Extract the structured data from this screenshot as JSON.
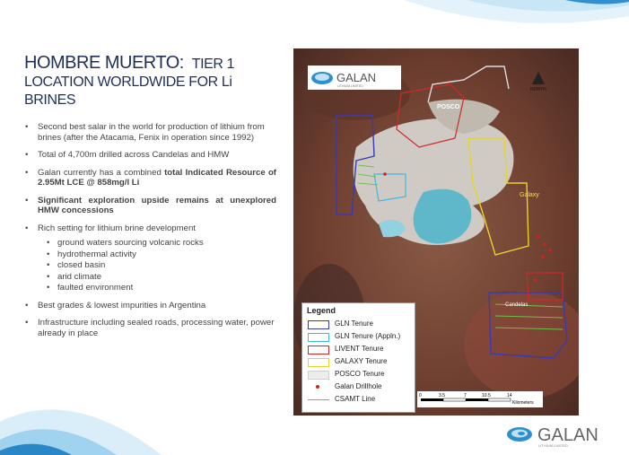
{
  "title": {
    "main": "HOMBRE MUERTO:",
    "tier": "TIER 1",
    "line2": "LOCATION WORLDWIDE FOR Li",
    "line3": "BRINES"
  },
  "bullets": [
    {
      "text": "Second best salar in the world for production of lithium from brines (after the Atacama, Fenix in operation since 1992)"
    },
    {
      "text": "Total of 4,700m drilled across Candelas and HMW"
    },
    {
      "prefix": "Galan currently has a combined ",
      "bold": "total Indicated Resource of 2.95Mt LCE @ 858mg/l Li"
    },
    {
      "bold": "Significant exploration upside remains at unexplored HMW concessions"
    },
    {
      "text": "Rich setting for lithium brine development",
      "sub": [
        "ground waters sourcing volcanic rocks",
        "hydrothermal activity",
        "closed basin",
        "arid climate",
        "faulted environment"
      ]
    },
    {
      "text": "Best grades & lowest impurities in Argentina"
    },
    {
      "text": "Infrastructure including sealed roads, processing water, power already in place"
    }
  ],
  "bullet_glyph": "•",
  "map": {
    "labels": {
      "posco": "POSCO",
      "galaxy": "Galaxy",
      "north": "NORTH",
      "candelas": "Candelas"
    },
    "scale": {
      "ticks": [
        "0",
        "3.5",
        "7",
        "10.5",
        "14"
      ],
      "unit": "Kilometers"
    },
    "logo": {
      "name": "GALAN",
      "sub": "LITHIUM LIMITED"
    }
  },
  "legend": {
    "title": "Legend",
    "items": [
      {
        "label": "GLN Tenure",
        "color": "#3a3ab0",
        "type": "box"
      },
      {
        "label": "GLN Tenure (Appln.)",
        "color": "#40b8e8",
        "type": "box"
      },
      {
        "label": "LIVENT Tenure",
        "color": "#cc2a2a",
        "type": "box"
      },
      {
        "label": "GALAXY Tenure",
        "color": "#e8d32a",
        "type": "box"
      },
      {
        "label": "POSCO Tenure",
        "color": "#dddddd",
        "type": "box"
      },
      {
        "label": "Galan Drillhole",
        "color": "#d42020",
        "type": "dot"
      },
      {
        "label": "CSAMT Line",
        "color": "#6fc04a",
        "type": "line"
      }
    ]
  },
  "footer_logo": {
    "name": "GALAN",
    "sub": "LITHIUM LIMITED"
  },
  "colors": {
    "title": "#1f2f55",
    "brand_blue": "#1e7fc8",
    "light_blue": "#bfe3f5"
  }
}
